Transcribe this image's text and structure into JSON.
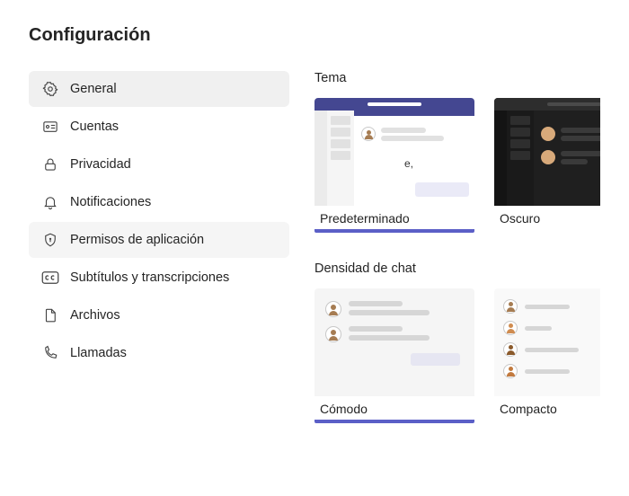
{
  "page_title": "Configuración",
  "sidebar": {
    "items": [
      {
        "label": "General",
        "icon": "gear"
      },
      {
        "label": "Cuentas",
        "icon": "accounts"
      },
      {
        "label": "Privacidad",
        "icon": "lock"
      },
      {
        "label": "Notificaciones",
        "icon": "bell"
      },
      {
        "label": "Permisos de aplicación",
        "icon": "shield"
      },
      {
        "label": "Subtítulos y transcripciones",
        "icon": "cc"
      },
      {
        "label": "Archivos",
        "icon": "file"
      },
      {
        "label": "Llamadas",
        "icon": "phone"
      }
    ]
  },
  "main": {
    "theme_section_title": "Tema",
    "themes": [
      {
        "label": "Predeterminado",
        "kind": "default"
      },
      {
        "label": "Oscuro",
        "kind": "dark"
      }
    ],
    "density_section_title": "Densidad de chat",
    "densities": [
      {
        "label": "Cómodo",
        "kind": "comfy"
      },
      {
        "label": "Compacto",
        "kind": "compact"
      }
    ],
    "preview_text": "e,"
  }
}
